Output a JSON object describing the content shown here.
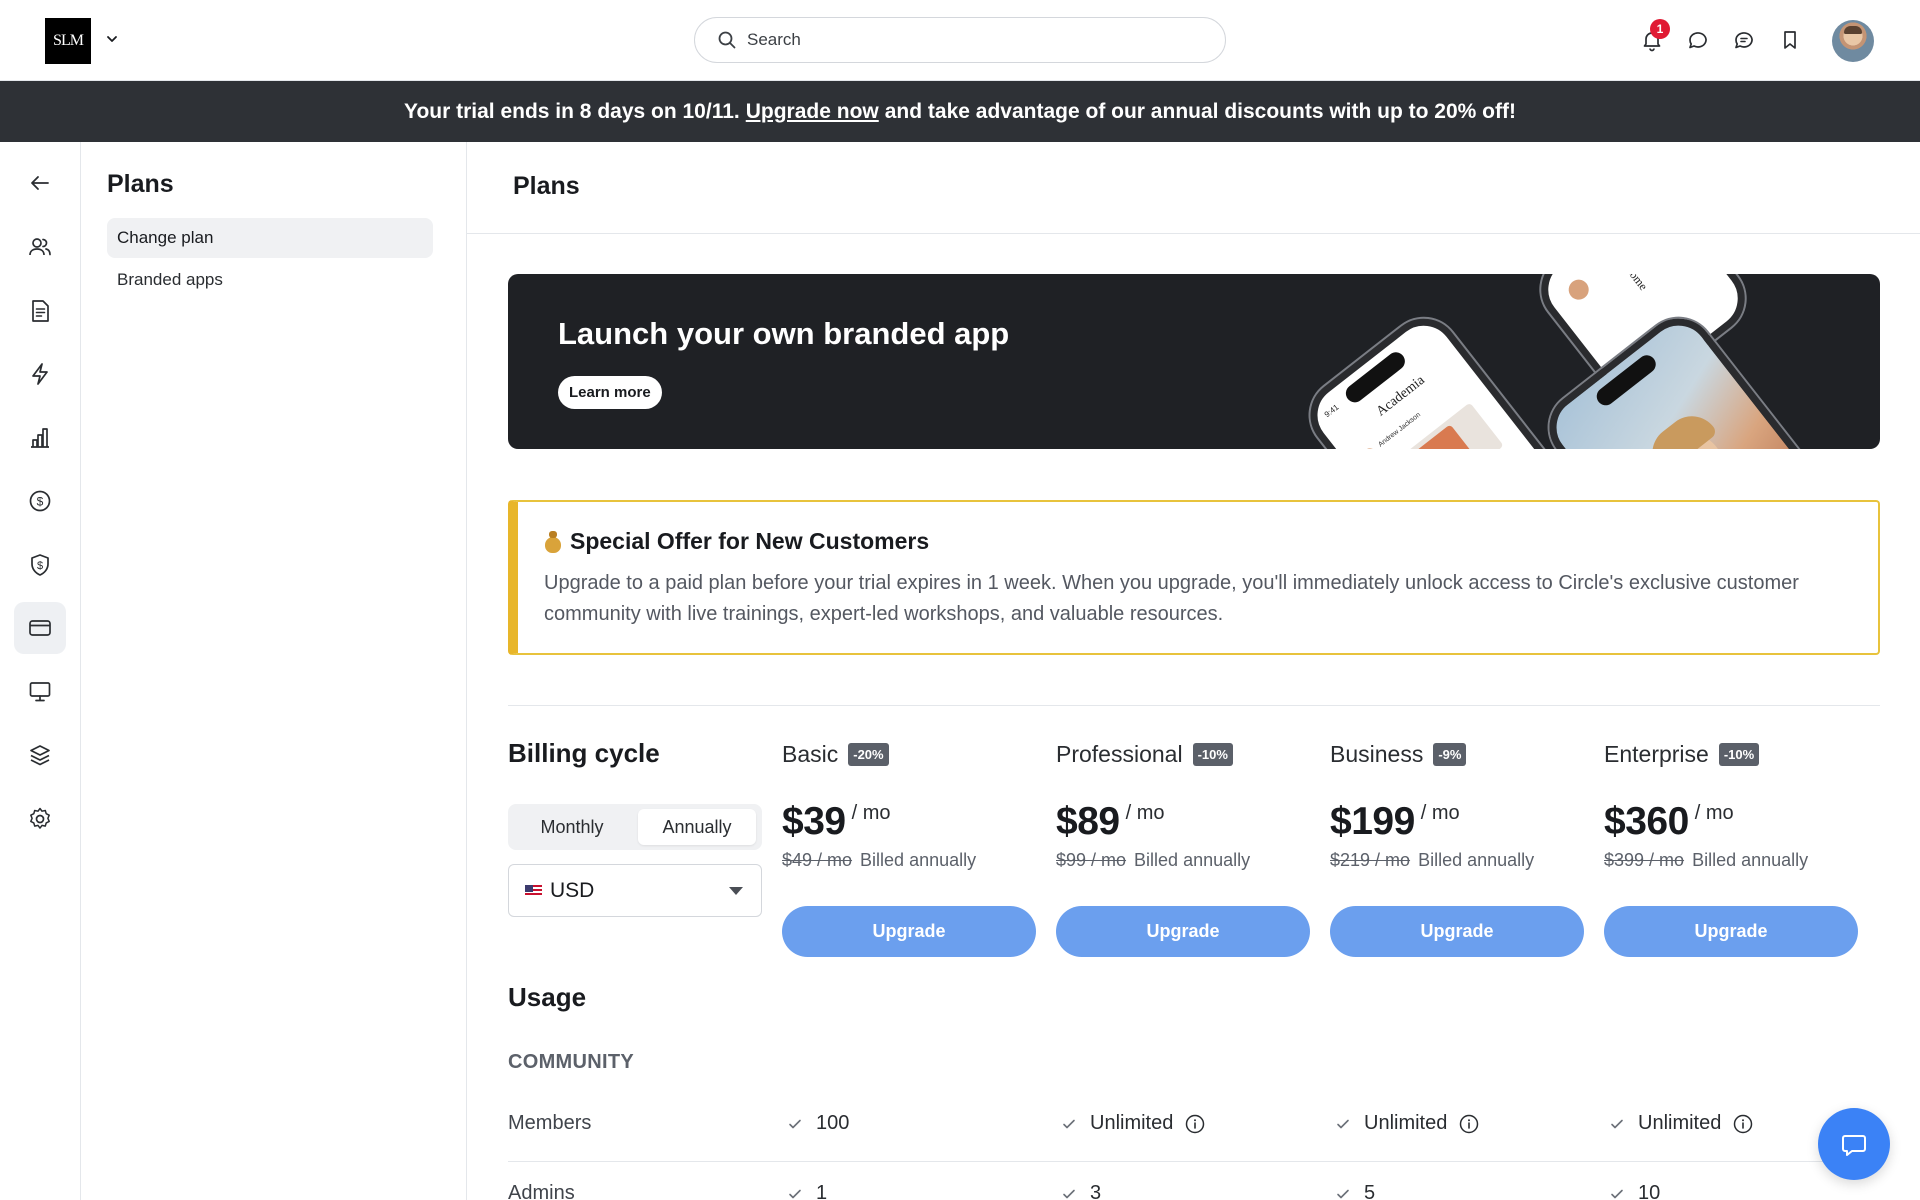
{
  "header": {
    "logo_text": "SLM",
    "search_placeholder": "Search",
    "notification_count": "1",
    "icons": [
      "chevron-down-icon",
      "search-icon",
      "bell-icon",
      "chat-bubble-icon",
      "messages-icon",
      "bookmark-icon"
    ]
  },
  "trial_banner": {
    "prefix": "Your trial ends in 8 days on 10/11.",
    "link": "Upgrade now",
    "suffix": "and take advantage of our annual discounts with up to 20% off!"
  },
  "rail": {
    "icons": [
      "back-arrow-icon",
      "members-icon",
      "posts-icon",
      "workflows-icon",
      "analytics-icon",
      "paywalls-icon",
      "affiliates-icon",
      "billing-icon",
      "site-icon",
      "apps-icon",
      "settings-icon"
    ],
    "active": "billing-icon"
  },
  "subnav": {
    "title": "Plans",
    "items": [
      {
        "label": "Change plan",
        "active": true
      },
      {
        "label": "Branded apps",
        "active": false
      }
    ]
  },
  "main": {
    "title": "Plans",
    "promo": {
      "title": "Launch your own branded app",
      "button": "Learn more",
      "phone_text_1": "Academia",
      "phone_text_2": "Welcome",
      "phone_time": "9:41",
      "phone_user": "Andrew Jackson"
    },
    "offer": {
      "title": "Special Offer for New Customers",
      "body": "Upgrade to a paid plan before your trial expires in 1 week. When you upgrade, you'll immediately unlock access to Circle's exclusive customer community with live trainings, expert-led workshops, and valuable resources."
    },
    "billing": {
      "title": "Billing cycle",
      "options": [
        "Monthly",
        "Annually"
      ],
      "selected": "Annually",
      "currency": "USD"
    },
    "plans": [
      {
        "name": "Basic",
        "discount": "-20%",
        "price": "$39",
        "per": "/ mo",
        "old_price": "$49 / mo",
        "billed": "Billed annually",
        "button": "Upgrade"
      },
      {
        "name": "Professional",
        "discount": "-10%",
        "price": "$89",
        "per": "/ mo",
        "old_price": "$99 / mo",
        "billed": "Billed annually",
        "button": "Upgrade"
      },
      {
        "name": "Business",
        "discount": "-9%",
        "price": "$199",
        "per": "/ mo",
        "old_price": "$219 / mo",
        "billed": "Billed annually",
        "button": "Upgrade"
      },
      {
        "name": "Enterprise",
        "discount": "-10%",
        "price": "$360",
        "per": "/ mo",
        "old_price": "$399 / mo",
        "billed": "Billed annually",
        "button": "Upgrade"
      }
    ],
    "usage": {
      "title": "Usage",
      "section": "COMMUNITY",
      "rows": [
        {
          "label": "Members",
          "values": [
            "100",
            "Unlimited",
            "Unlimited",
            "Unlimited"
          ]
        },
        {
          "label": "Admins",
          "values": [
            "1",
            "3",
            "5",
            "10"
          ]
        }
      ]
    }
  },
  "colors": {
    "accent": "#6B9FEE",
    "banner_bg": "#2E3136",
    "promo_bg": "#1F2125",
    "offer_border": "#E8B62A",
    "badge": "#E01A33",
    "chat_button": "#3B82F6"
  }
}
